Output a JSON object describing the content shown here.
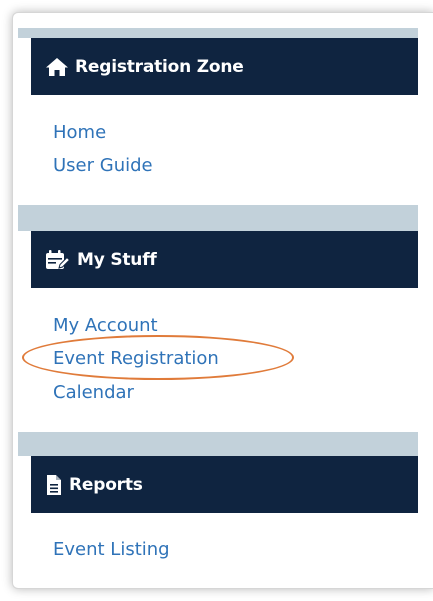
{
  "sections": [
    {
      "title": "Registration Zone",
      "icon": "home-icon",
      "links": [
        "Home",
        "User Guide"
      ]
    },
    {
      "title": "My Stuff",
      "icon": "calendar-edit-icon",
      "links": [
        "My Account",
        "Event Registration",
        "Calendar"
      ]
    },
    {
      "title": "Reports",
      "icon": "document-icon",
      "links": [
        "Event Listing"
      ]
    }
  ],
  "colors": {
    "header_bg": "#0f2440",
    "band_bg": "#c2d1da",
    "link": "#2f73b8",
    "highlight": "#e07b3a"
  },
  "highlighted_link": "Event Registration"
}
